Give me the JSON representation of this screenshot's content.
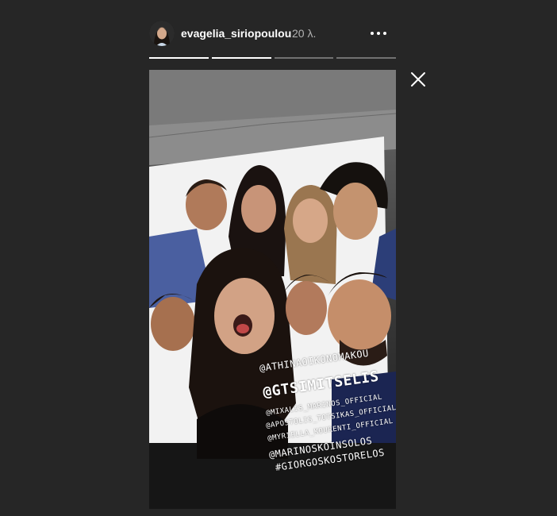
{
  "header": {
    "username": "evagelia_siriopoulou",
    "timestamp": "20 λ.",
    "more_icon": "more-horizontal-icon"
  },
  "progress": [
    1,
    1,
    0,
    0
  ],
  "close_icon": "close-icon",
  "story": {
    "mentions": [
      "@ATHINAOIKONOMAKOU",
      "@GTSIMITSELIS",
      "@MIXALIS_MARINOS_OFFICIAL",
      "@APOSTOLIS_TOTSIKAS_OFFICIAL",
      "@MYRIELLA_KOURENTI_OFFICIAL",
      "@MARINOSKOINSOLOS",
      "#GIORGOSKOSTORELOS"
    ]
  },
  "colors": {
    "background": "#262626",
    "text": "#ffffff",
    "muted_text": "#b3b3b3"
  }
}
